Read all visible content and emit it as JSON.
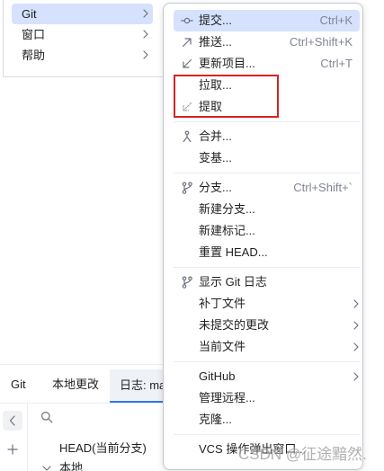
{
  "colors": {
    "highlight": "#d5e1fd",
    "annotation": "#d52323",
    "accent": "#3574f0",
    "shortcut_text": "#818594"
  },
  "main_menu": {
    "items": [
      {
        "label": "Git",
        "selected": true,
        "submenu": true
      },
      {
        "label": "窗口",
        "submenu": true
      },
      {
        "label": "帮助",
        "submenu": true
      }
    ]
  },
  "git_menu": {
    "items": [
      {
        "label": "提交...",
        "shortcut": "Ctrl+K",
        "icon": "commit-icon",
        "selected": true
      },
      {
        "label": "推送...",
        "shortcut": "Ctrl+Shift+K",
        "icon": "push-icon"
      },
      {
        "label": "更新项目...",
        "shortcut": "Ctrl+T",
        "icon": "update-project-icon"
      },
      {
        "label": "拉取..."
      },
      {
        "label": "提取",
        "icon": "fetch-icon"
      },
      {
        "label": "合并...",
        "icon": "merge-icon"
      },
      {
        "label": "变基..."
      },
      {
        "label": "分支...",
        "shortcut": "Ctrl+Shift+`",
        "icon": "branch-icon"
      },
      {
        "label": "新建分支..."
      },
      {
        "label": "新建标记..."
      },
      {
        "label": "重置 HEAD..."
      },
      {
        "label": "显示 Git 日志",
        "icon": "git-log-icon"
      },
      {
        "label": "补丁文件",
        "submenu": true
      },
      {
        "label": "未提交的更改",
        "submenu": true
      },
      {
        "label": "当前文件",
        "submenu": true
      },
      {
        "label": "GitHub",
        "submenu": true
      },
      {
        "label": "管理远程..."
      },
      {
        "label": "克隆..."
      },
      {
        "label": "VCS 操作弹出窗口..."
      }
    ]
  },
  "tool_window": {
    "tabs": [
      {
        "label": "Git"
      },
      {
        "label": "本地更改"
      },
      {
        "label": "日志: ma",
        "selected": true
      }
    ],
    "toolbar": {
      "back_icon": "chevron-left-icon",
      "add_icon": "plus-icon",
      "search_icon": "search-icon"
    },
    "tree": [
      {
        "label": "HEAD(当前分支)"
      },
      {
        "label": "本地",
        "expanded": true
      }
    ]
  },
  "watermark": "CSDN @征途黯然."
}
